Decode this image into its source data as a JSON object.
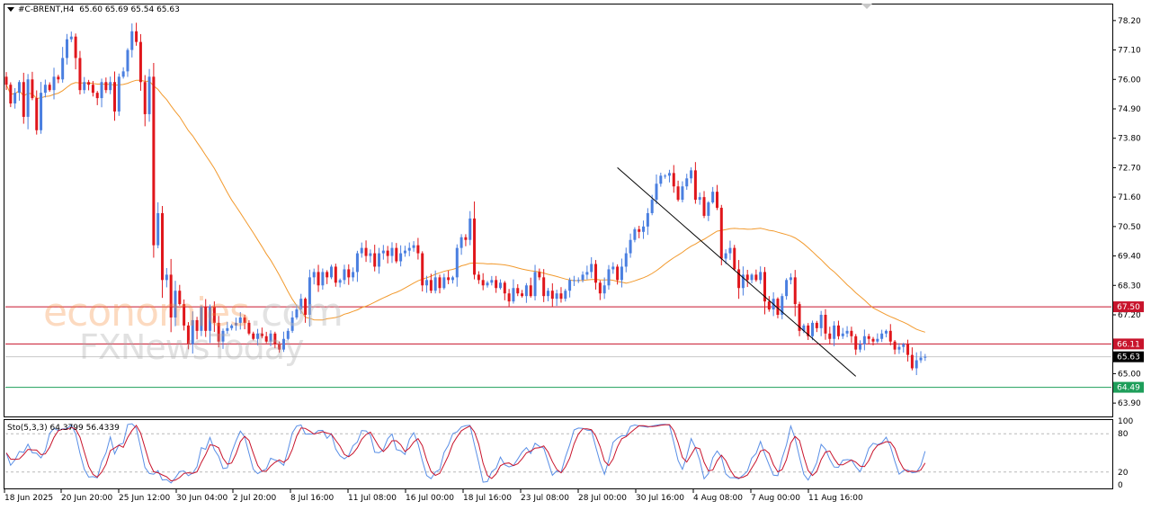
{
  "header": {
    "symbol": "#C-BRENT,H4",
    "ohlc": "65.60 65.69 65.54 65.63"
  },
  "indicator": {
    "label": "Sto(5,3,3) 64.3799 56.4339"
  },
  "watermark": {
    "line1_a": "economies",
    "line1_b": ".com",
    "line2": "FXNewsToday"
  },
  "colors": {
    "bull": "#4a7fe0",
    "bear": "#e0161b",
    "ma": "#f29a2e",
    "level": "#c8142c",
    "bid": "#1e9e5a",
    "stoch_main": "#5a8fe6",
    "stoch_signal": "#c8142c"
  },
  "chart_data": {
    "type": "candlestick",
    "symbol": "#C-BRENT",
    "timeframe": "H4",
    "ylim": [
      63.4,
      78.8
    ],
    "y_ticks": [
      "78.20",
      "77.10",
      "76.00",
      "74.90",
      "73.80",
      "72.70",
      "71.60",
      "70.50",
      "69.40",
      "68.30",
      "67.20",
      "65.00",
      "63.90"
    ],
    "x_ticks": [
      "18 Jun 2025",
      "20 Jun 20:00",
      "25 Jun 12:00",
      "30 Jun 04:00",
      "2 Jul 20:00",
      "8 Jul 16:00",
      "11 Jul 08:00",
      "16 Jul 00:00",
      "18 Jul 16:00",
      "23 Jul 08:00",
      "28 Jul 00:00",
      "30 Jul 16:00",
      "4 Aug 08:00",
      "7 Aug 00:00",
      "11 Aug 16:00"
    ],
    "price_levels": [
      {
        "value": 67.5,
        "label": "67.50",
        "kind": "resistance"
      },
      {
        "value": 66.11,
        "label": "66.11",
        "kind": "resistance"
      },
      {
        "value": 65.63,
        "label": "65.63",
        "kind": "current"
      },
      {
        "value": 64.49,
        "label": "64.49",
        "kind": "bid"
      }
    ],
    "trendline": {
      "from": {
        "bar": 141,
        "price": 72.7
      },
      "to": {
        "bar": 196,
        "price": 64.9
      }
    },
    "closes": [
      75.8,
      75.1,
      75.5,
      75.9,
      74.6,
      76.0,
      75.3,
      74.1,
      75.5,
      75.8,
      75.6,
      76.1,
      76.0,
      76.8,
      77.5,
      77.6,
      76.8,
      75.6,
      75.9,
      75.8,
      75.5,
      75.3,
      75.9,
      75.6,
      75.9,
      74.8,
      76.1,
      76.3,
      77.1,
      77.8,
      77.4,
      75.9,
      74.7,
      76.1,
      69.8,
      71.0,
      68.5,
      68.7,
      67.1,
      68.1,
      67.6,
      66.8,
      66.1,
      67.0,
      66.6,
      67.5,
      66.6,
      67.5,
      66.9,
      66.2,
      66.6,
      66.7,
      66.8,
      66.9,
      67.1,
      66.9,
      66.5,
      66.3,
      66.5,
      66.4,
      66.2,
      66.5,
      66.1,
      65.9,
      66.3,
      66.6,
      67.1,
      67.4,
      67.8,
      67.2,
      68.6,
      68.8,
      68.3,
      68.8,
      68.6,
      69.0,
      68.4,
      68.5,
      68.9,
      68.6,
      68.8,
      69.5,
      69.7,
      69.4,
      69.5,
      69.0,
      69.5,
      69.6,
      69.4,
      69.7,
      69.2,
      69.5,
      69.6,
      69.7,
      69.8,
      69.5,
      68.3,
      68.5,
      68.1,
      68.6,
      68.2,
      68.6,
      68.5,
      68.6,
      69.7,
      70.1,
      70.0,
      70.8,
      68.7,
      68.5,
      68.3,
      68.4,
      68.5,
      68.2,
      68.4,
      68.0,
      67.7,
      68.2,
      68.0,
      67.9,
      68.3,
      67.9,
      68.8,
      68.6,
      67.9,
      68.1,
      67.8,
      68.0,
      67.8,
      68.1,
      68.5,
      68.5,
      68.5,
      68.7,
      68.8,
      69.1,
      68.4,
      68.0,
      68.3,
      68.9,
      69.0,
      68.5,
      69.0,
      69.5,
      70.0,
      70.4,
      70.3,
      70.5,
      71.0,
      71.5,
      72.1,
      72.4,
      72.4,
      72.5,
      72.0,
      71.5,
      72.0,
      72.3,
      72.6,
      71.5,
      71.6,
      70.9,
      71.4,
      71.8,
      71.2,
      69.3,
      69.5,
      69.7,
      68.9,
      68.2,
      68.7,
      68.5,
      68.7,
      68.5,
      68.8,
      67.7,
      67.4,
      67.8,
      67.2,
      67.9,
      68.5,
      68.6,
      67.6,
      66.6,
      66.8,
      66.4,
      66.9,
      66.7,
      67.2,
      66.5,
      66.3,
      66.8,
      66.4,
      66.5,
      66.6,
      66.4,
      65.9,
      66.1,
      66.4,
      66.3,
      66.2,
      66.3,
      66.5,
      66.6,
      66.2,
      65.9,
      66.0,
      66.1,
      65.7,
      65.2,
      65.5,
      65.6,
      65.63
    ]
  }
}
